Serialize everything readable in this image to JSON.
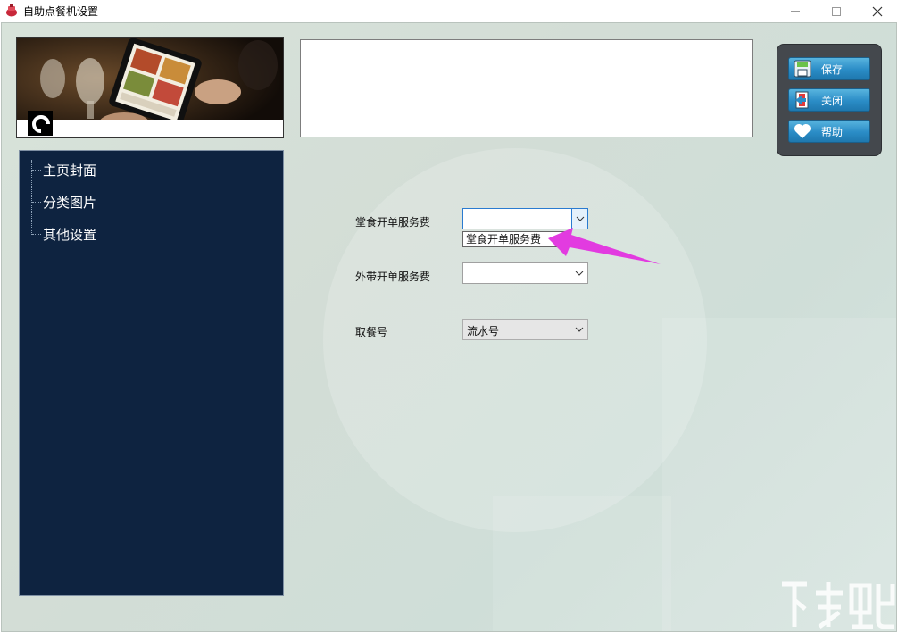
{
  "window": {
    "title": "自助点餐机设置",
    "controls": {
      "minimize": "—",
      "maximize": "☐",
      "close": "✕"
    }
  },
  "sidebar": {
    "items": [
      {
        "label": "主页封面"
      },
      {
        "label": "分类图片"
      },
      {
        "label": "其他设置"
      }
    ]
  },
  "toolbar": {
    "save_label": "保存",
    "close_label": "关闭",
    "help_label": "帮助"
  },
  "form": {
    "dine_in_fee": {
      "label": "堂食开单服务费",
      "value": "",
      "dropdown_open": true,
      "options": [
        "堂食开单服务费"
      ]
    },
    "takeout_fee": {
      "label": "外带开单服务费",
      "value": ""
    },
    "pickup_number": {
      "label": "取餐号",
      "value": "流水号"
    }
  },
  "colors": {
    "sidebar_bg": "#0e2340",
    "button_blue": "#2a8cc6",
    "panel_dark": "#44484d",
    "annotation_arrow": "#e23be0"
  }
}
